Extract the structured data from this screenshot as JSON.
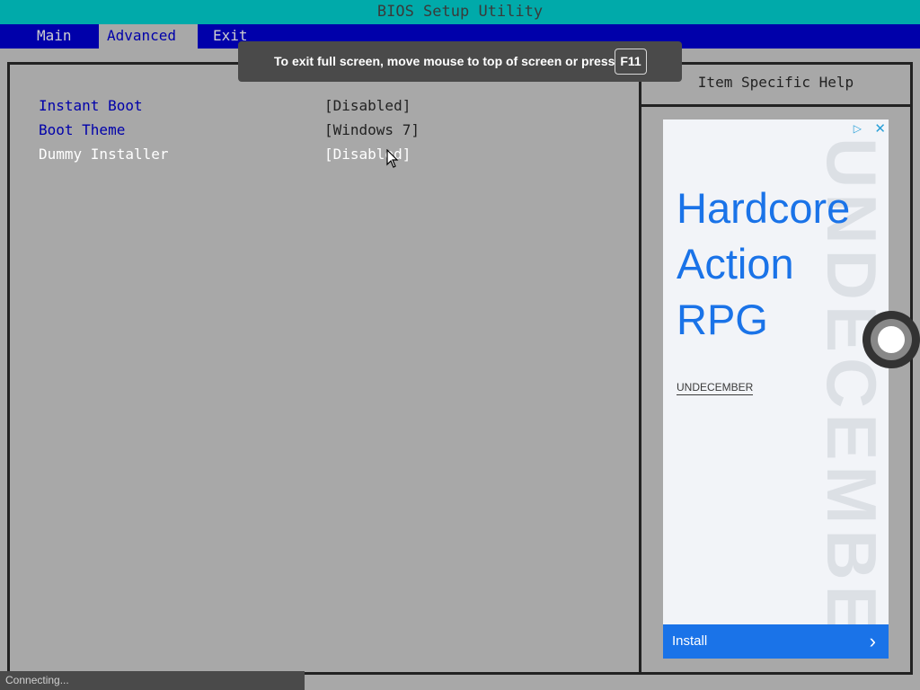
{
  "titlebar": {
    "title": "BIOS Setup Utility"
  },
  "menu": [
    {
      "label": "Main",
      "active": false
    },
    {
      "label": "Advanced",
      "active": true
    },
    {
      "label": "Exit",
      "active": false
    }
  ],
  "help_panel": {
    "title": "Item Specific Help"
  },
  "settings": [
    {
      "label": "Instant Boot",
      "value": "[Disabled]",
      "selected": false
    },
    {
      "label": "Boot Theme",
      "value": "[Windows 7]",
      "selected": false
    },
    {
      "label": "Dummy Installer",
      "value": "[Disabled]",
      "selected": true
    }
  ],
  "fullscreen_toast": {
    "message": "To exit full screen, move mouse to top of screen or press",
    "key": "F11"
  },
  "ad": {
    "headline_lines": [
      "Hardcore",
      "Action",
      "RPG"
    ],
    "brand": "UNDECEMBER",
    "watermark": "UNDECEMBER",
    "cta": "Install",
    "adchoices_icon": "adchoices-icon",
    "close_icon": "close-icon",
    "cta_icon": "chevron-right-icon"
  },
  "status": {
    "text": "Connecting..."
  },
  "colors": {
    "bios_cyan": "#00aaaa",
    "bios_blue": "#0000aa",
    "bios_gray": "#a8a8a8",
    "ad_blue": "#1a73e8"
  }
}
